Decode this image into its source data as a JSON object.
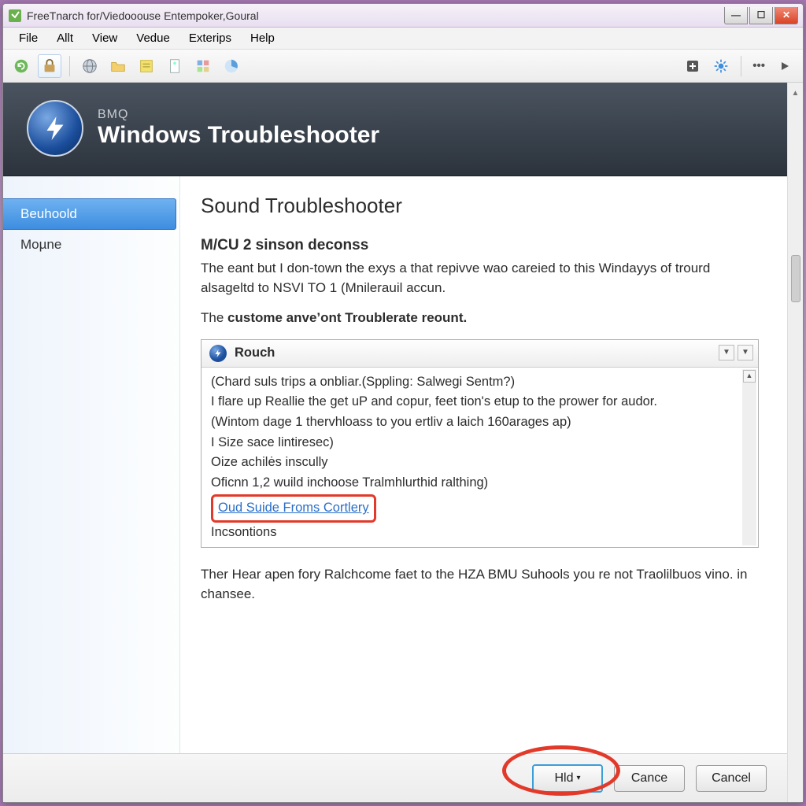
{
  "window": {
    "title": "FreeTnarch for/Viedooouse Entempoker,Goural"
  },
  "menubar": [
    "File",
    "Allt",
    "View",
    "Vedue",
    "Exterips",
    "Help"
  ],
  "banner": {
    "overline": "BMQ",
    "title": "Windows Troubleshooter"
  },
  "sidebar": {
    "items": [
      {
        "label": "Beuhoold",
        "active": true
      },
      {
        "label": "Moµne",
        "active": false
      }
    ]
  },
  "content": {
    "heading": "Sound Troubleshooter",
    "subheading": "M/CU 2 sinson deconss",
    "para1": "The eant but I don-town the exys a that repivve wao careied to this Windayys of trourd alsageltd to NSVI TO 1 (Mnilerauil accun.",
    "para2": "The custome anve'ont Troublerate reount.",
    "listbox": {
      "header": "Rouch",
      "lines": [
        "(Chard suls trips a onbliar.(Sppling: Salwegi Sentm?)",
        "I flare up Reallie the get uP and copur, feet tion's etup to the prower for audor.",
        "(Wintom dage 1 thervhloass to you ertliv a laich 160arages ap)",
        "I Size sace lintiresec)",
        "Oize achilės inscully",
        "Oficnn 1,2 wuild inchoose Tralmhlurthid ralthing)"
      ],
      "highlight_link": "Oud Suide Froms Cortlery",
      "last_line": "Incsontions"
    },
    "footer_text": "Ther Hear apen fory Ralchcome faet to the HZA BMU Suhools you re not Traolilbuos vino. in chansee."
  },
  "buttons": {
    "primary": "Hld",
    "secondary": "Cance",
    "tertiary": "Cancel"
  }
}
